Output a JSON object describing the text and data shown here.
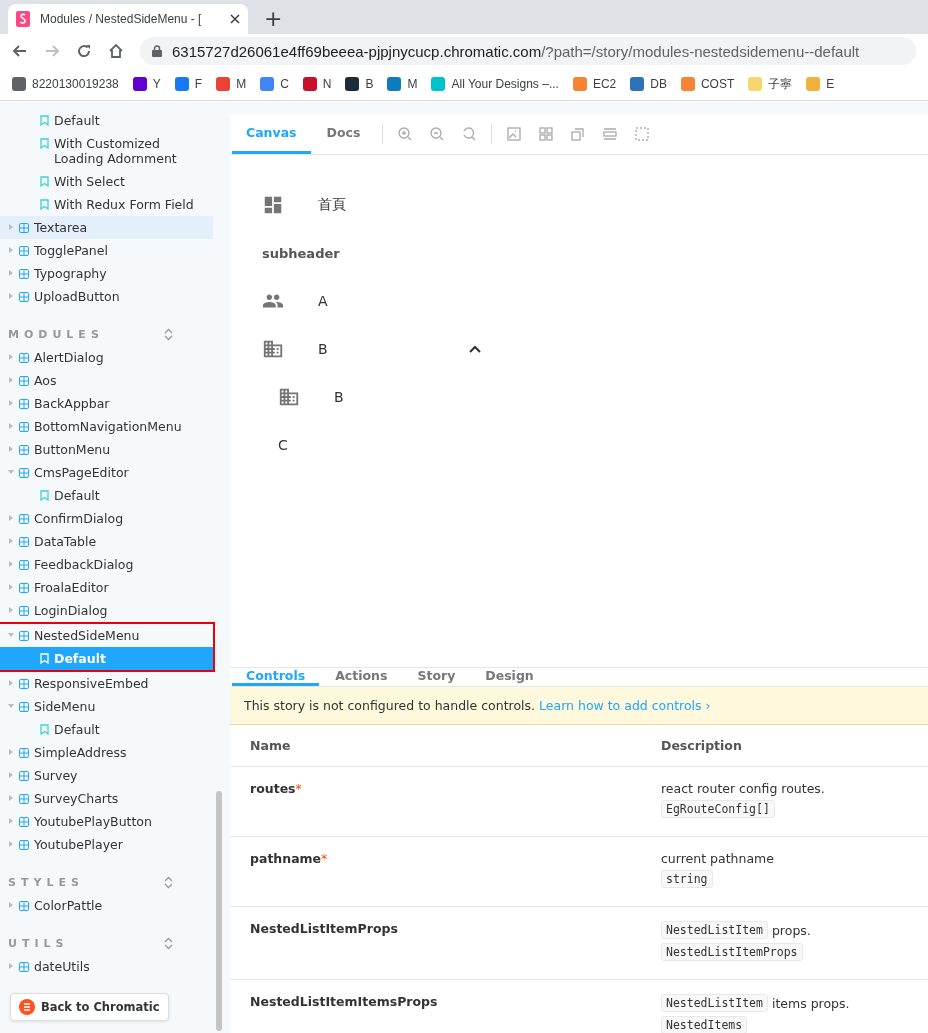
{
  "browser": {
    "tab_title": "Modules / NestedSideMenu - [",
    "new_tab": "+",
    "url_host": "6315727d26061e4ff69beeea-pjpjnycucp.chromatic.com",
    "url_path": "/?path=/story/modules-nestedsidemenu--default",
    "bookmarks": [
      {
        "label": "8220130019238",
        "color": "#5f6368"
      },
      {
        "label": "Y",
        "color": "#6001d2"
      },
      {
        "label": "F",
        "color": "#1877f2"
      },
      {
        "label": "M",
        "color": "#ea4335"
      },
      {
        "label": "C",
        "color": "#4285f4"
      },
      {
        "label": "N",
        "color": "#c8102e"
      },
      {
        "label": "B",
        "color": "#1d2b3a"
      },
      {
        "label": "M",
        "color": "#0f7bbf"
      },
      {
        "label": "All Your Designs –...",
        "color": "#00c4cc"
      },
      {
        "label": "EC2",
        "color": "#f58534"
      },
      {
        "label": "DB",
        "color": "#2e73b8"
      },
      {
        "label": "COST",
        "color": "#f58534"
      },
      {
        "label": "子寧",
        "color": "#f5d76e"
      },
      {
        "label": "E",
        "color": "#f0b23c"
      }
    ]
  },
  "sidebar": {
    "sections": [
      {
        "items": [
          {
            "kind": "story",
            "label": "Default",
            "selected": false
          },
          {
            "kind": "story",
            "label": "With Customized Loading Adornment",
            "selected": false
          },
          {
            "kind": "story",
            "label": "With Select",
            "selected": false
          },
          {
            "kind": "story",
            "label": "With Redux Form Field",
            "selected": false
          },
          {
            "kind": "component",
            "label": "Textarea",
            "expanded": false,
            "hovered": true
          },
          {
            "kind": "component",
            "label": "TogglePanel",
            "expanded": false,
            "hovered": false
          },
          {
            "kind": "component",
            "label": "Typography",
            "expanded": false,
            "hovered": false
          },
          {
            "kind": "component",
            "label": "UploadButton",
            "expanded": false,
            "hovered": false
          }
        ]
      },
      {
        "title": "MODULES",
        "items": [
          {
            "kind": "component",
            "label": "AlertDialog",
            "expanded": false,
            "hovered": false
          },
          {
            "kind": "component",
            "label": "Aos",
            "expanded": false,
            "hovered": false
          },
          {
            "kind": "component",
            "label": "BackAppbar",
            "expanded": false,
            "hovered": false
          },
          {
            "kind": "component",
            "label": "BottomNavigationMenu",
            "expanded": false,
            "hovered": false
          },
          {
            "kind": "component",
            "label": "ButtonMenu",
            "expanded": false,
            "hovered": false
          },
          {
            "kind": "component",
            "label": "CmsPageEditor",
            "expanded": true,
            "hovered": false,
            "children": [
              {
                "kind": "story",
                "label": "Default",
                "selected": false
              }
            ]
          },
          {
            "kind": "component",
            "label": "ConfirmDialog",
            "expanded": false,
            "hovered": false
          },
          {
            "kind": "component",
            "label": "DataTable",
            "expanded": false,
            "hovered": false
          },
          {
            "kind": "component",
            "label": "FeedbackDialog",
            "expanded": false,
            "hovered": false
          },
          {
            "kind": "component",
            "label": "FroalaEditor",
            "expanded": false,
            "hovered": false
          },
          {
            "kind": "component",
            "label": "LoginDialog",
            "expanded": false,
            "hovered": false
          },
          {
            "kind": "component",
            "label": "NestedSideMenu",
            "expanded": true,
            "hovered": false,
            "annotated": true,
            "children": [
              {
                "kind": "story",
                "label": "Default",
                "selected": true
              }
            ]
          },
          {
            "kind": "component",
            "label": "ResponsiveEmbed",
            "expanded": false,
            "hovered": false
          },
          {
            "kind": "component",
            "label": "SideMenu",
            "expanded": true,
            "hovered": false,
            "children": [
              {
                "kind": "story",
                "label": "Default",
                "selected": false
              }
            ]
          },
          {
            "kind": "component",
            "label": "SimpleAddress",
            "expanded": false,
            "hovered": false
          },
          {
            "kind": "component",
            "label": "Survey",
            "expanded": false,
            "hovered": false
          },
          {
            "kind": "component",
            "label": "SurveyCharts",
            "expanded": false,
            "hovered": false
          },
          {
            "kind": "component",
            "label": "YoutubePlayButton",
            "expanded": false,
            "hovered": false
          },
          {
            "kind": "component",
            "label": "YoutubePlayer",
            "expanded": false,
            "hovered": false
          }
        ]
      },
      {
        "title": "STYLES",
        "items": [
          {
            "kind": "component",
            "label": "ColorPattle",
            "expanded": false,
            "hovered": false
          }
        ]
      },
      {
        "title": "UTILS",
        "items": [
          {
            "kind": "component",
            "label": "dateUtils",
            "expanded": false,
            "hovered": false
          }
        ]
      }
    ],
    "back_button": "Back to Chromatic"
  },
  "toolbar": {
    "tabs": [
      {
        "label": "Canvas",
        "selected": true
      },
      {
        "label": "Docs",
        "selected": false
      }
    ]
  },
  "canvas": {
    "menu": [
      {
        "kind": "icon_item",
        "label": "首頁"
      },
      {
        "kind": "subheader",
        "label": "subheader"
      },
      {
        "kind": "icon_item",
        "label": "A"
      },
      {
        "kind": "icon_item",
        "label": "B",
        "expanded": true,
        "children": [
          {
            "kind": "icon_item",
            "label": "B"
          },
          {
            "kind": "text_item",
            "label": "C"
          }
        ]
      }
    ]
  },
  "addons": {
    "tabs": [
      {
        "label": "Controls",
        "selected": true
      },
      {
        "label": "Actions",
        "selected": false
      },
      {
        "label": "Story",
        "selected": false
      },
      {
        "label": "Design",
        "selected": false
      }
    ],
    "notice": {
      "text": "This story is not configured to handle controls.",
      "link": "Learn how to add controls",
      "link_arrow": "›"
    },
    "table": {
      "columns": [
        "Name",
        "Description"
      ],
      "rows": [
        {
          "name": "routes",
          "required": true,
          "required_mark": "*",
          "description": [
            [
              {
                "kind": "text",
                "text": "react router config routes."
              }
            ],
            [
              {
                "kind": "code",
                "text": "EgRouteConfig[]"
              }
            ]
          ]
        },
        {
          "name": "pathname",
          "required": true,
          "required_mark": "*",
          "description": [
            [
              {
                "kind": "text",
                "text": "current pathname"
              }
            ],
            [
              {
                "kind": "code",
                "text": "string"
              }
            ]
          ]
        },
        {
          "name": "NestedListItemProps",
          "description": [
            [
              {
                "kind": "code",
                "text": "NestedListItem"
              },
              {
                "kind": "text",
                "text": "props."
              }
            ],
            [
              {
                "kind": "code",
                "text": "NestedListItemProps"
              }
            ]
          ]
        },
        {
          "name": "NestedListItemItemsProps",
          "description": [
            [
              {
                "kind": "code",
                "text": "NestedListItem"
              },
              {
                "kind": "text",
                "text": "items props."
              }
            ],
            [
              {
                "kind": "code",
                "text": "NestedItems"
              }
            ]
          ]
        }
      ]
    }
  }
}
